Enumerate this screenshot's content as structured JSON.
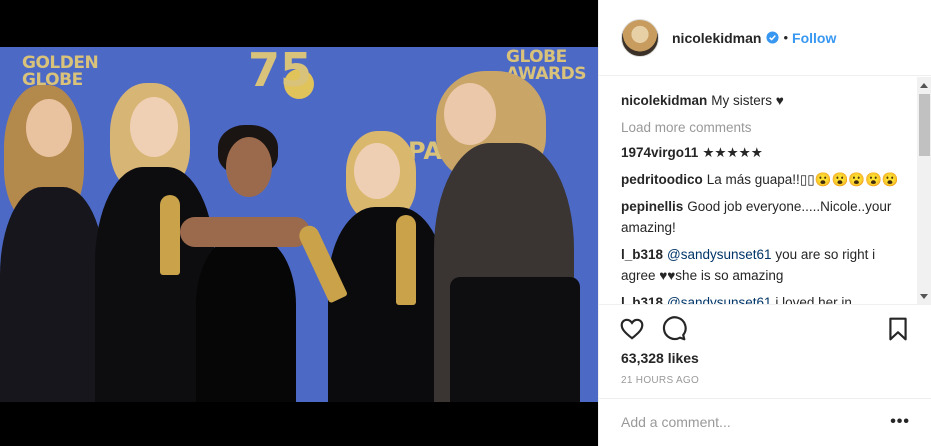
{
  "photo": {
    "backdrop_golden": "GOLDEN GLOBE",
    "backdrop_awards": "GLOBE AWARDS",
    "backdrop_75": "75",
    "backdrop_pa": "PA"
  },
  "header": {
    "username": "nicolekidman",
    "separator": "•",
    "follow_label": "Follow"
  },
  "comments": {
    "caption": {
      "user": "nicolekidman",
      "text": "My sisters ♥"
    },
    "load_more": "Load more comments",
    "items": [
      {
        "user": "1974virgo11",
        "mention": "",
        "text": "★★★★★"
      },
      {
        "user": "pedritoodico",
        "mention": "",
        "text": "La más guapa!!▯▯😮😮😮😮😮"
      },
      {
        "user": "pepinellis",
        "mention": "",
        "text": "Good job everyone.....Nicole..your amazing!"
      },
      {
        "user": "l_b318",
        "mention": "@sandysunset61",
        "text": "you are so right i agree ♥♥she is so amazing"
      },
      {
        "user": "l_b318",
        "mention": "@sandysunset61",
        "text": "i loved her in"
      }
    ]
  },
  "actions": {
    "like_icon": "heart-icon",
    "comment_icon": "comment-icon",
    "save_icon": "bookmark-icon"
  },
  "likes": "63,328 likes",
  "timestamp": "21 HOURS AGO",
  "add_comment": {
    "placeholder": "Add a comment...",
    "more": "•••"
  },
  "colors": {
    "accent": "#3897f0",
    "verified": "#3897f0",
    "backdrop": "#4d69c6"
  }
}
